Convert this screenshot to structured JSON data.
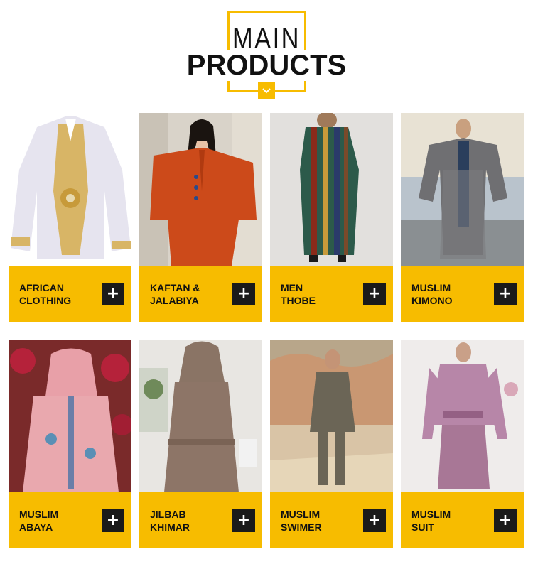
{
  "header": {
    "title_top": "MAIN",
    "title_bottom": "PRODUCTS",
    "chevron_icon": "chevron-down-icon",
    "accent_color": "#F7BC00"
  },
  "products": [
    {
      "line1": "AFRICAN",
      "line2": "CLOTHING",
      "button": "+"
    },
    {
      "line1": "KAFTAN &",
      "line2": "JALABIYA",
      "button": "+"
    },
    {
      "line1": "MEN",
      "line2": "THOBE",
      "button": "+"
    },
    {
      "line1": "MUSLIM",
      "line2": "KIMONO",
      "button": "+"
    },
    {
      "line1": "MUSLIM",
      "line2": "ABAYA",
      "button": "+"
    },
    {
      "line1": "JILBAB",
      "line2": "KHIMAR",
      "button": "+"
    },
    {
      "line1": "MUSLIM",
      "line2": "SWIMER",
      "button": "+"
    },
    {
      "line1": "MUSLIM",
      "line2": "SUIT",
      "button": "+"
    }
  ]
}
